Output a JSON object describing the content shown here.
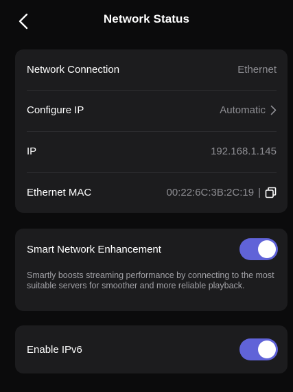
{
  "header": {
    "title": "Network Status",
    "back_icon": "chevron-left-icon"
  },
  "network": {
    "rows": [
      {
        "label": "Network Connection",
        "value": "Ethernet"
      },
      {
        "label": "Configure IP",
        "value": "Automatic",
        "icon": "chevron-right-icon"
      },
      {
        "label": "IP",
        "value": "192.168.1.145"
      },
      {
        "label": "Ethernet MAC",
        "value": "00:22:6C:3B:2C:19",
        "separator": "|",
        "icon": "copy-icon"
      }
    ]
  },
  "smart": {
    "label": "Smart Network Enhancement",
    "enabled": true,
    "description": "Smartly boosts streaming performance by connecting to the most suitable servers for smoother and more reliable playback."
  },
  "ipv6": {
    "label": "Enable IPv6",
    "enabled": true
  },
  "colors": {
    "background": "#0b0b0c",
    "card": "#1c1c1e",
    "toggle_on": "#6063d8",
    "secondary_text": "#8e8e93"
  }
}
